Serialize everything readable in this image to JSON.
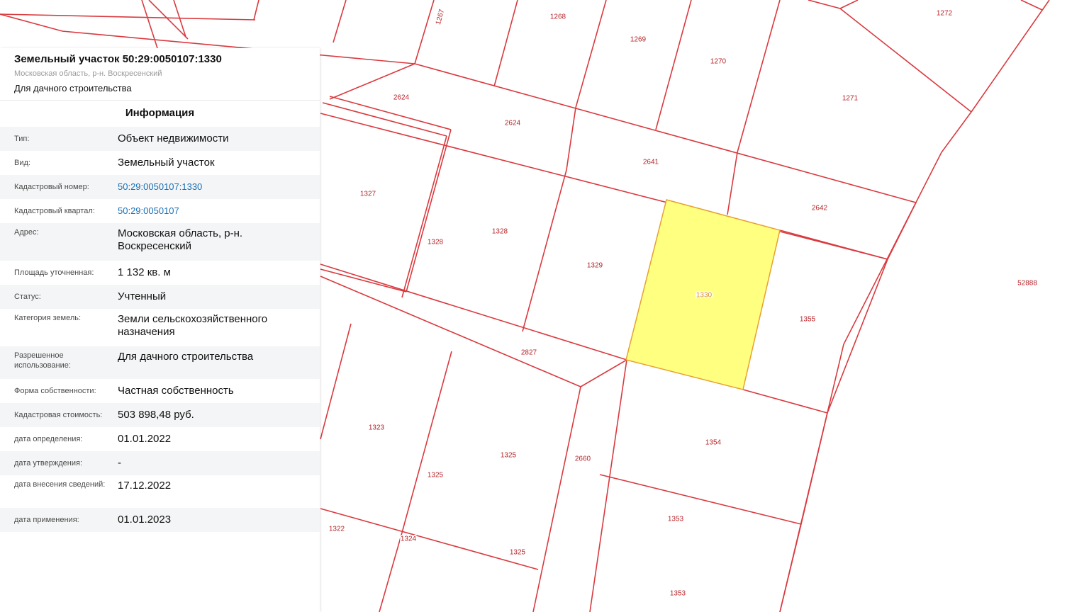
{
  "panel": {
    "title": "Земельный участок 50:29:0050107:1330",
    "subtitle": "Московская область, р-н. Воскресенский",
    "use": "Для дачного строительства",
    "section_title": "Информация",
    "rows": [
      {
        "label": "Тип:",
        "value": "Объект недвижимости"
      },
      {
        "label": "Вид:",
        "value": "Земельный участок"
      },
      {
        "label": "Кадастровый номер:",
        "value": "50:29:0050107:1330"
      },
      {
        "label": "Кадастровый квартал:",
        "value": "50:29:0050107"
      },
      {
        "label": "Адрес:",
        "value": "Московская область, р-н. Воскресенский"
      },
      {
        "label": "Площадь уточненная:",
        "value": "1 132 кв. м"
      },
      {
        "label": "Статус:",
        "value": "Учтенный"
      },
      {
        "label": "Категория земель:",
        "value": "Земли сельскохозяйственного назначения"
      },
      {
        "label": "Разрешенное использование:",
        "value": "Для дачного строительства"
      },
      {
        "label": "Форма собственности:",
        "value": "Частная собственность"
      },
      {
        "label": "Кадастровая стоимость:",
        "value": "503 898,48 руб."
      },
      {
        "label": "дата определения:",
        "value": "01.01.2022"
      },
      {
        "label": "дата утверждения:",
        "value": "-"
      },
      {
        "label": "дата внесения сведений:",
        "value": "17.12.2022"
      },
      {
        "label": "дата применения:",
        "value": "01.01.2023"
      }
    ]
  },
  "map": {
    "colors": {
      "boundary": "#d93a3f",
      "selected_fill": "#ffff80",
      "selected_stroke": "#e8a030"
    },
    "selected_parcel": "1330",
    "parcel_labels": [
      "1267",
      "1268",
      "1269",
      "1270",
      "1271",
      "1272",
      "2624",
      "2624",
      "2641",
      "2642",
      "1327",
      "1328",
      "1328",
      "1329",
      "1330",
      "1355",
      "52888",
      "2827",
      "1323",
      "1325",
      "1325",
      "2660",
      "1354",
      "1353",
      "1353",
      "1322",
      "1324",
      "1325"
    ]
  }
}
